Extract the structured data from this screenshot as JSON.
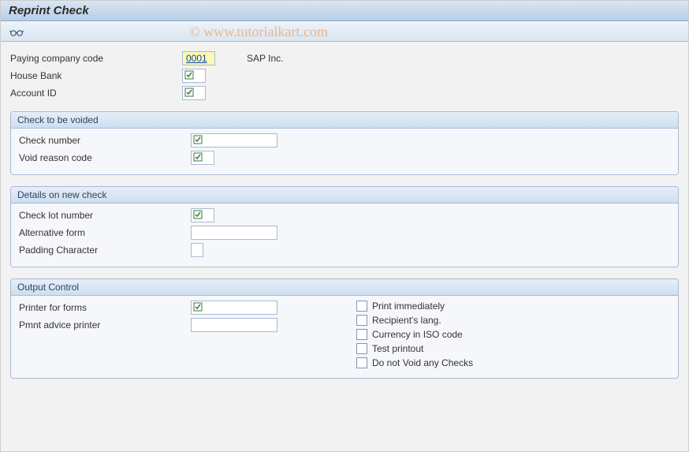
{
  "title": "Reprint Check",
  "watermark": "© www.tutorialkart.com",
  "top": {
    "paying_company_code_label": "Paying company code",
    "paying_company_code_value": "0001",
    "company_name": "SAP Inc.",
    "house_bank_label": "House Bank",
    "house_bank_value": "",
    "account_id_label": "Account ID",
    "account_id_value": ""
  },
  "group1": {
    "title": "Check to be voided",
    "check_number_label": "Check number",
    "check_number_value": "",
    "void_reason_label": "Void reason code",
    "void_reason_value": ""
  },
  "group2": {
    "title": "Details on new check",
    "check_lot_label": "Check lot number",
    "check_lot_value": "",
    "alt_form_label": "Alternative form",
    "alt_form_value": "",
    "padding_label": "Padding Character",
    "padding_value": ""
  },
  "group3": {
    "title": "Output Control",
    "printer_forms_label": "Printer for forms",
    "printer_forms_value": "",
    "pmnt_advice_label": "Pmnt advice printer",
    "pmnt_advice_value": "",
    "cb1": "Print immediately",
    "cb2": "Recipient's lang.",
    "cb3": "Currency in ISO code",
    "cb4": "Test printout",
    "cb5": "Do not Void any Checks"
  }
}
